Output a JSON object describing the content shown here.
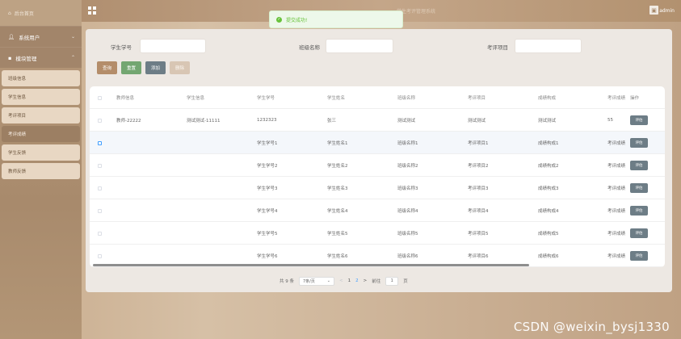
{
  "sidebar": {
    "home": "后台首页",
    "groups": [
      {
        "label": "系统用户",
        "chevron": "⌄",
        "icon": "user-icon"
      },
      {
        "label": "模块管理",
        "chevron": "⌃",
        "icon": "grid-icon"
      }
    ],
    "items": [
      {
        "label": "班级信息"
      },
      {
        "label": "学生信息"
      },
      {
        "label": "考评项目"
      },
      {
        "label": "考评成绩"
      },
      {
        "label": "学生反馈"
      },
      {
        "label": "教师反馈"
      }
    ],
    "active_index": 3
  },
  "topbar": {
    "title": "学生考评管理系统",
    "user": "admin"
  },
  "toast": {
    "message": "提交成功!"
  },
  "search": {
    "fields": [
      {
        "label": "学生学号",
        "value": ""
      },
      {
        "label": "班级名称",
        "value": ""
      },
      {
        "label": "考评项目",
        "value": ""
      }
    ]
  },
  "buttons": {
    "search": "查询",
    "reset": "重置",
    "add": "添加",
    "delete": "删除"
  },
  "table": {
    "columns": [
      "教师信息",
      "学生信息",
      "学生学号",
      "学生姓名",
      "班级名称",
      "考评项目",
      "成绩构成",
      "考评成绩",
      "操作"
    ],
    "action_label": "评估",
    "rows": [
      [
        "教师-22222",
        "测试测试-11111",
        "1232323",
        "张三",
        "测试测试",
        "测试测试",
        "测试测试",
        "55"
      ],
      [
        "",
        "",
        "学生学号1",
        "学生姓名1",
        "班级名称1",
        "考评项目1",
        "成绩构成1",
        "考评成绩"
      ],
      [
        "",
        "",
        "学生学号2",
        "学生姓名2",
        "班级名称2",
        "考评项目2",
        "成绩构成2",
        "考评成绩"
      ],
      [
        "",
        "",
        "学生学号3",
        "学生姓名3",
        "班级名称3",
        "考评项目3",
        "成绩构成3",
        "考评成绩"
      ],
      [
        "",
        "",
        "学生学号4",
        "学生姓名4",
        "班级名称4",
        "考评项目4",
        "成绩构成4",
        "考评成绩"
      ],
      [
        "",
        "",
        "学生学号5",
        "学生姓名5",
        "班级名称5",
        "考评项目5",
        "成绩构成5",
        "考评成绩"
      ],
      [
        "",
        "",
        "学生学号6",
        "学生姓名6",
        "班级名称6",
        "考评项目6",
        "成绩构成6",
        "考评成绩"
      ]
    ],
    "highlighted_row": 1
  },
  "pagination": {
    "total": "共 9 条",
    "page_size": "7条/页",
    "prev": "<",
    "pages": [
      "1",
      "2"
    ],
    "current": "2",
    "next": ">",
    "goto": "前往",
    "goto_value": "1",
    "page_suffix": "页"
  },
  "watermark": "CSDN @weixin_bysj1330",
  "colors": {
    "sidebar": "#a88a6c",
    "active_item": "#9c7f63",
    "search_btn": "#b48d6a",
    "reset_btn": "#73a671",
    "add_btn": "#6d7d86",
    "success": "#67c23a",
    "link": "#409eff"
  }
}
